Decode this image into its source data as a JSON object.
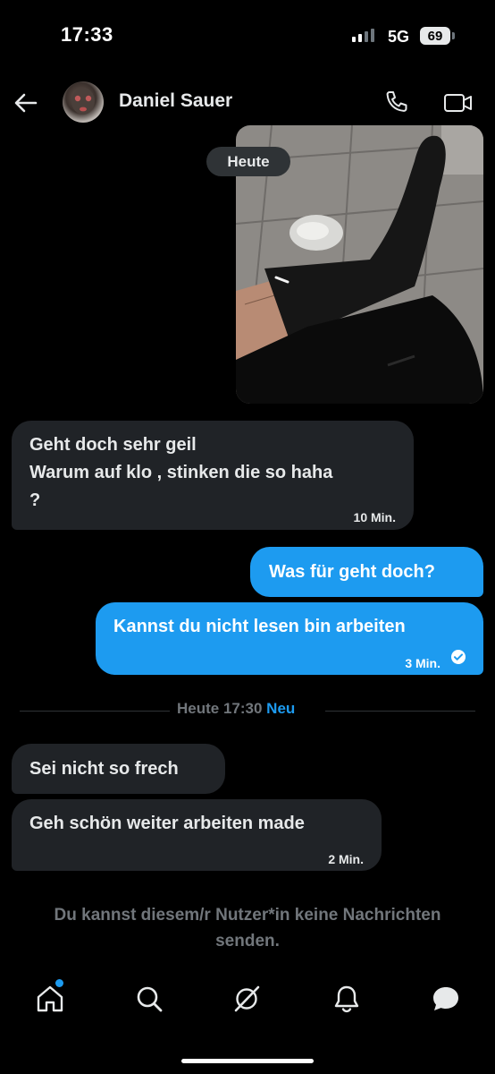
{
  "status_bar": {
    "time": "17:33",
    "network": "5G",
    "battery": "69"
  },
  "header": {
    "contact_name": "Daniel Sauer"
  },
  "day_label": "Heute",
  "messages": [
    {
      "direction": "in",
      "lines": [
        "Geht doch sehr geil",
        "Warum auf klo , stinken die so haha",
        "?"
      ],
      "time": "10 Min."
    },
    {
      "direction": "out",
      "text": "Was für geht doch?"
    },
    {
      "direction": "out",
      "text": "Kannst du nicht lesen bin arbeiten",
      "time": "3 Min.",
      "status": "read"
    }
  ],
  "divider": {
    "label": "Heute 17:30",
    "new_label": "Neu"
  },
  "new_messages": [
    {
      "direction": "in",
      "text": "Sei nicht so frech"
    },
    {
      "direction": "in",
      "text": "Geh schön weiter arbeiten made",
      "time": "2 Min."
    }
  ],
  "notice": "Du kannst diesem/r Nutzer*in keine Nachrichten senden.",
  "nav": {
    "items": [
      "home-icon",
      "search-icon",
      "grok-icon",
      "notifications-icon",
      "messages-icon"
    ],
    "active": "messages-icon",
    "badge": "home-icon"
  },
  "colors": {
    "accent": "#1d9bf0",
    "bubble_in": "#202327",
    "muted_text": "#71767b",
    "background": "#000000"
  }
}
